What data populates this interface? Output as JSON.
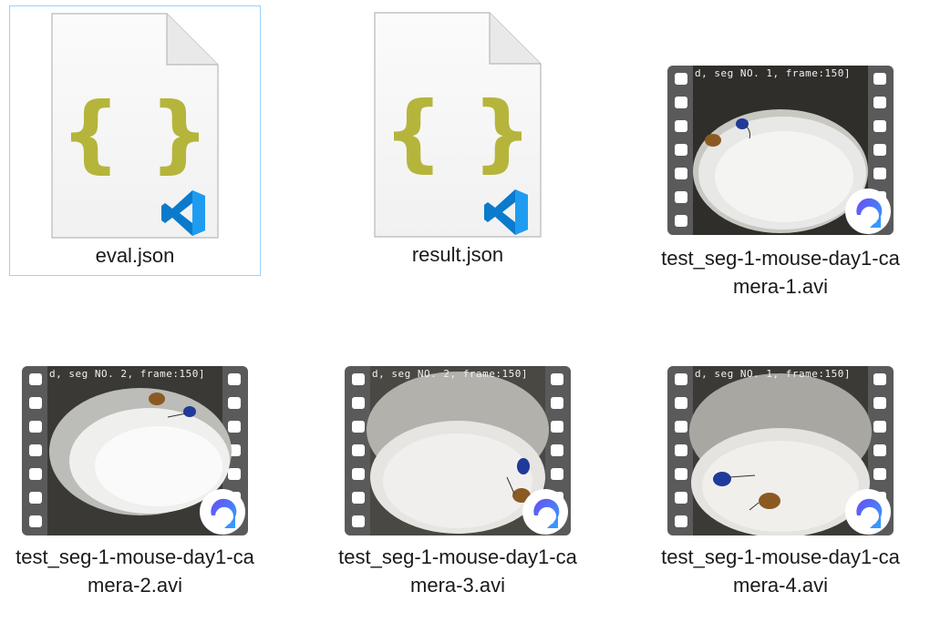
{
  "files": [
    {
      "name": "eval.json",
      "type": "json",
      "selected": true
    },
    {
      "name": "result.json",
      "type": "json",
      "selected": false
    },
    {
      "name": "test_seg-1-mouse-day1-camera-1.avi",
      "type": "video",
      "frame_text": "d, seg NO. 1, frame:150]",
      "selected": false
    },
    {
      "name": "test_seg-1-mouse-day1-camera-2.avi",
      "type": "video",
      "frame_text": "d, seg NO. 2, frame:150]",
      "selected": false
    },
    {
      "name": "test_seg-1-mouse-day1-camera-3.avi",
      "type": "video",
      "frame_text": "d, seg NO. 2, frame:150]",
      "selected": false
    },
    {
      "name": "test_seg-1-mouse-day1-camera-4.avi",
      "type": "video",
      "frame_text": "d, seg NO. 1, frame:150]",
      "selected": false
    }
  ],
  "colors": {
    "selection_border": "#99d1ff",
    "json_braces": "#b5b53c",
    "vscode_blue": "#0a7acc",
    "film_strip": "#555555",
    "player_badge": "#3b82f6"
  },
  "icons": {
    "json_file": "json-file-icon",
    "vscode": "vscode-icon",
    "video_thumbnail": "video-thumbnail-icon",
    "media_player": "media-player-icon"
  }
}
